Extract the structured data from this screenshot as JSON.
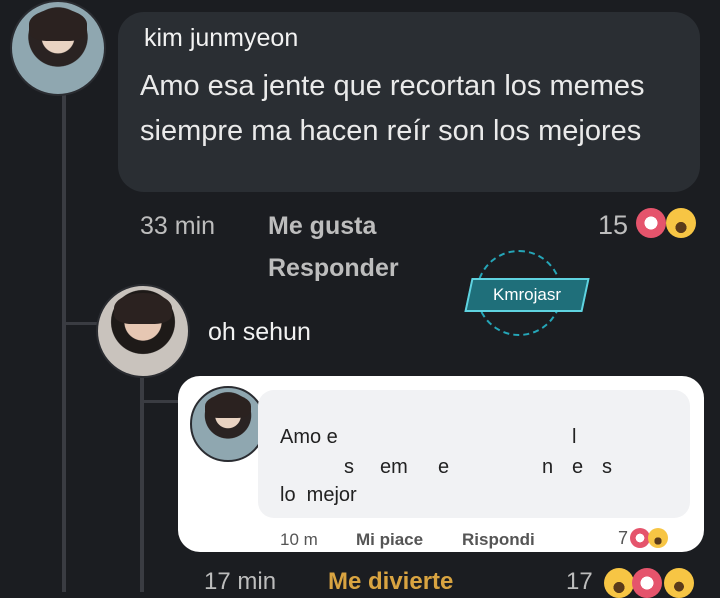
{
  "post": {
    "author": "kim junmyeon",
    "text": "Amo esa jente que recortan los memes siempre ma hacen reír son los mejores",
    "time": "33 min",
    "like_label": "Me gusta",
    "reply_label": "Responder",
    "reaction_count": "15"
  },
  "watermark": "Kmrojasr",
  "reply": {
    "author": "oh sehun",
    "inner": {
      "line1_a": "Amo e",
      "line1_b": "l",
      "line2_a": "s",
      "line2_b": "em",
      "line2_c": "e",
      "line2_d": "n",
      "line2_e": "e",
      "line2_f": "s",
      "line3": "lo  mejor",
      "time": "10 m",
      "like_label": "Mi piace",
      "reply_label": "Rispondi",
      "reaction_count": "7"
    },
    "time": "17 min",
    "like_label": "Me divierte",
    "reaction_count": "17"
  },
  "icons": {
    "heart": "heart-reaction-icon",
    "haha": "haha-reaction-icon",
    "wow": "wow-reaction-icon"
  },
  "colors": {
    "background": "#1b1d21",
    "bubble": "#2a2e33",
    "card": "#ffffff",
    "watermark": "#1f6f7a"
  }
}
